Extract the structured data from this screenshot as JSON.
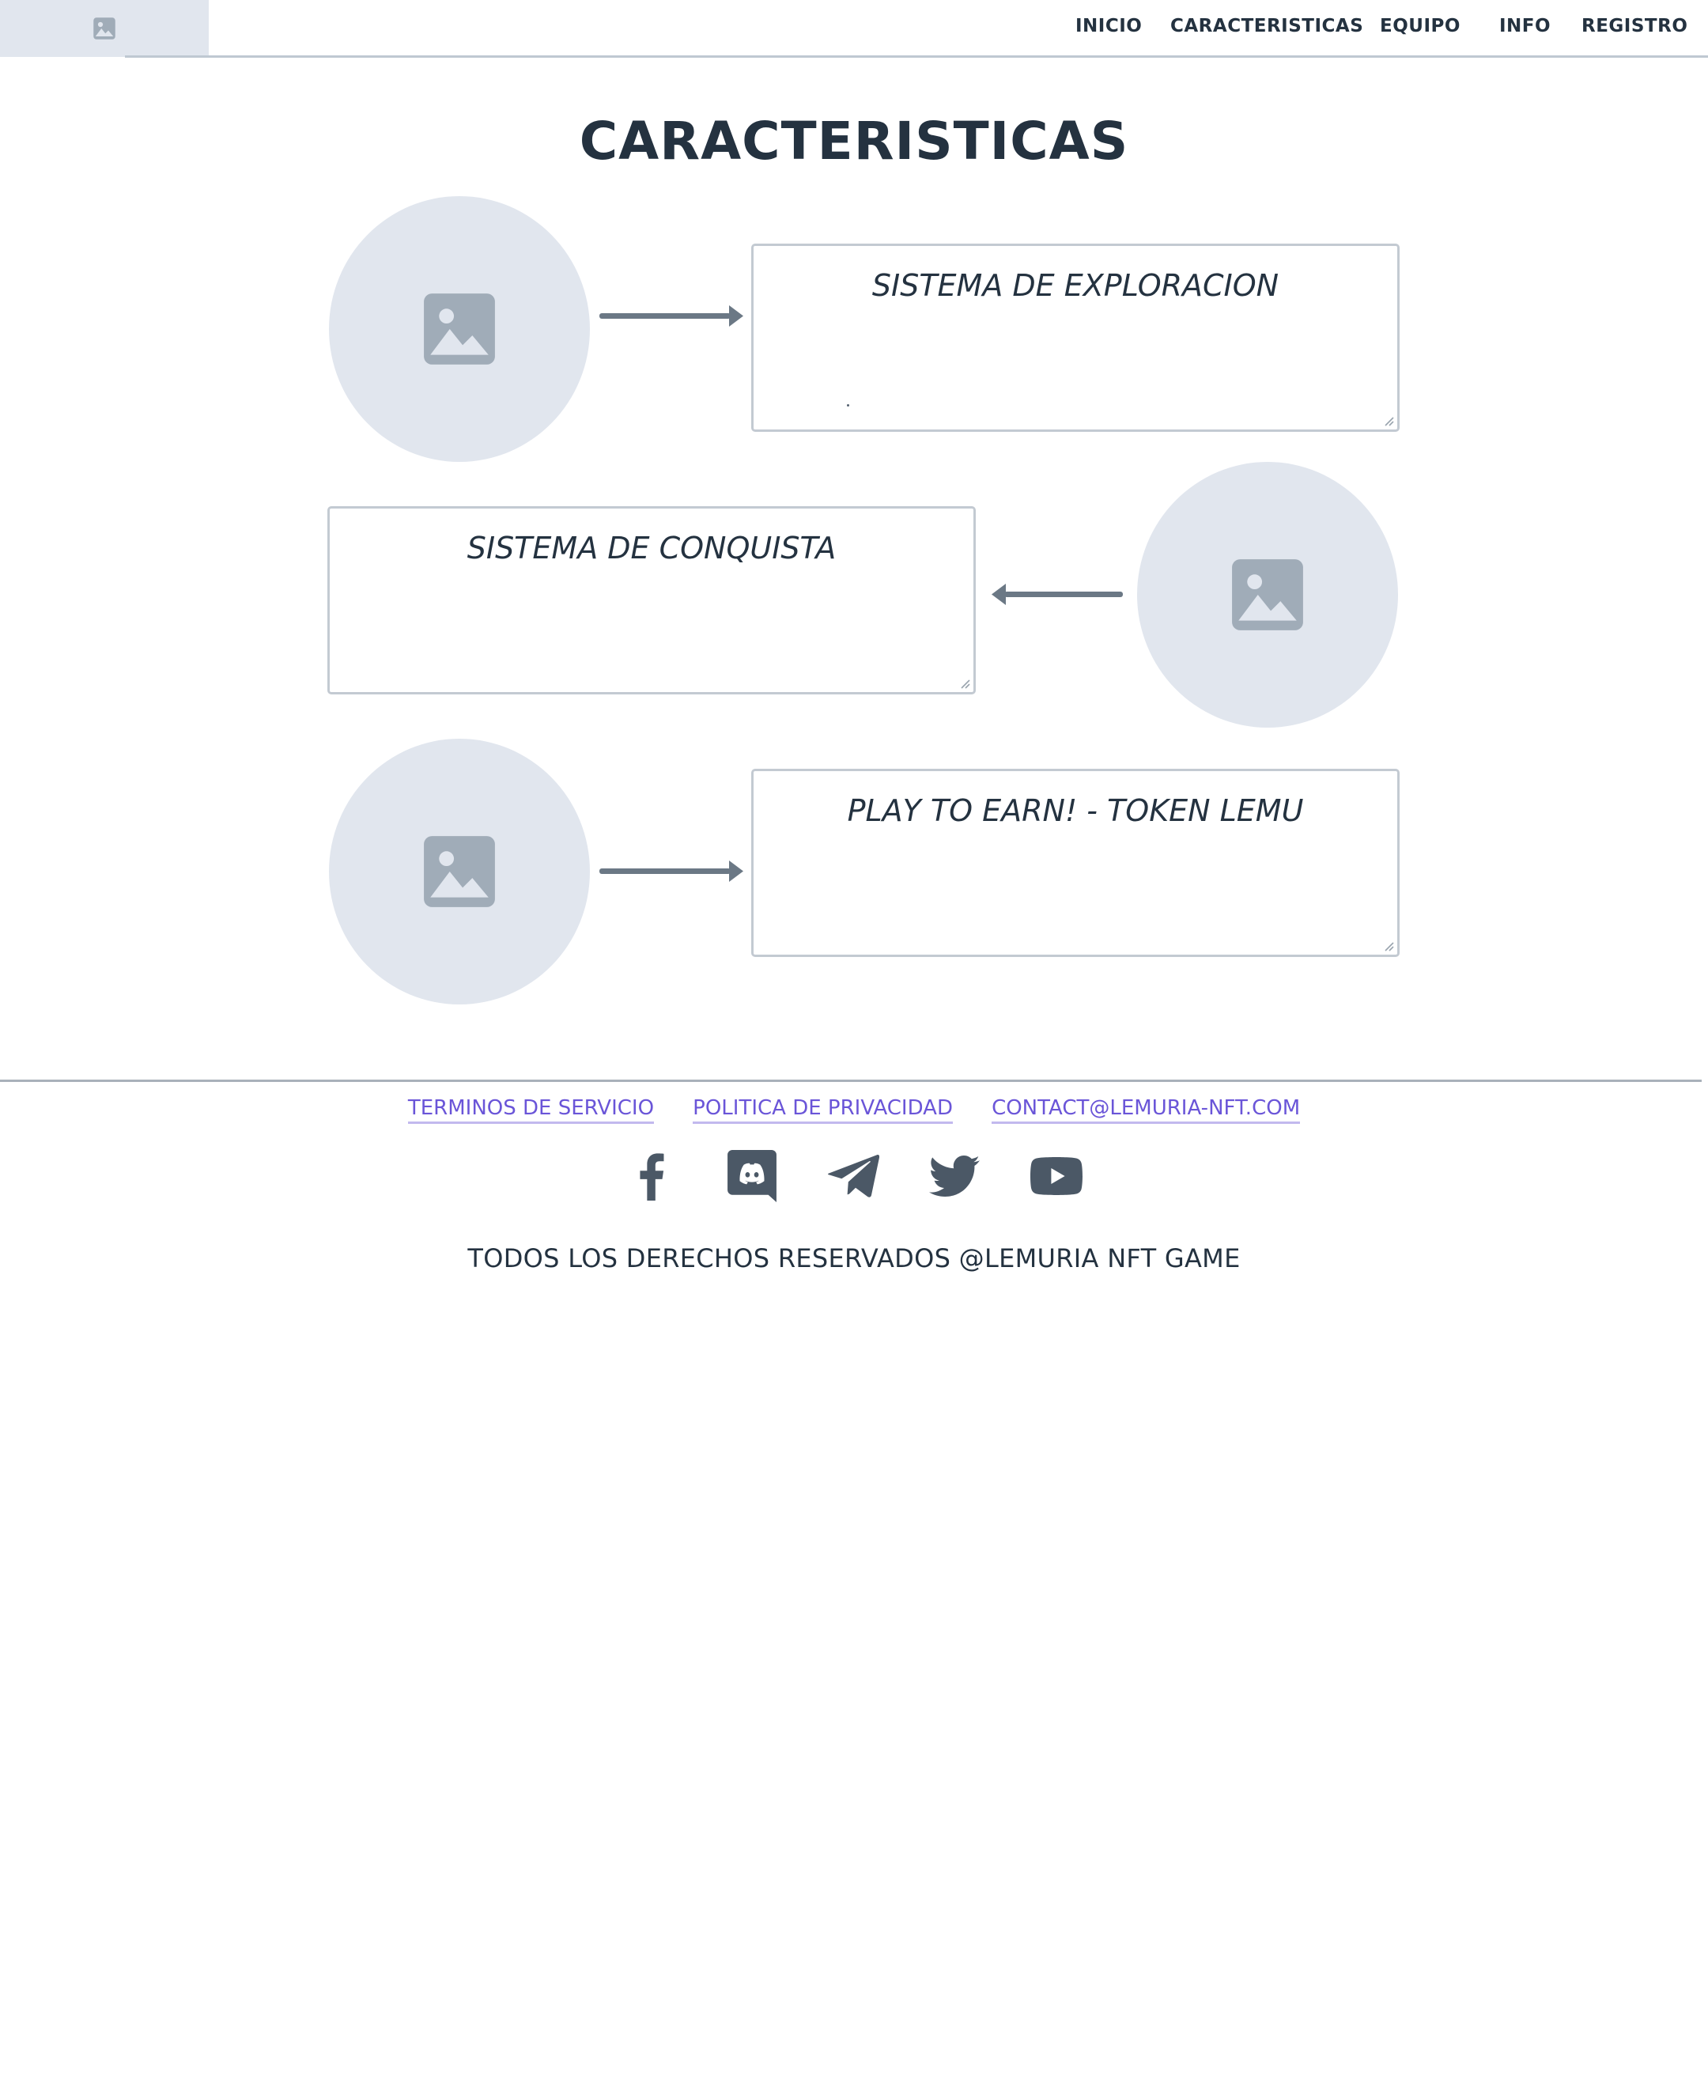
{
  "nav": {
    "logo_icon": "image-placeholder-icon",
    "items": [
      {
        "label": "INICIO"
      },
      {
        "label": "CARACTERISTICAS"
      },
      {
        "label": "EQUIPO"
      },
      {
        "label": "INFO"
      },
      {
        "label": "REGISTRO"
      }
    ]
  },
  "section": {
    "title": "CARACTERISTICAS",
    "features": [
      {
        "title": "SISTEMA DE EXPLORACION",
        "image_icon": "image-placeholder-icon",
        "arrow": "arrow-right-icon"
      },
      {
        "title": "SISTEMA DE CONQUISTA",
        "image_icon": "image-placeholder-icon",
        "arrow": "arrow-left-icon"
      },
      {
        "title": "PLAY TO EARN! - TOKEN LEMU",
        "image_icon": "image-placeholder-icon",
        "arrow": "arrow-right-icon"
      }
    ]
  },
  "footer": {
    "links": [
      {
        "label": "TERMINOS DE SERVICIO"
      },
      {
        "label": "POLITICA DE PRIVACIDAD"
      },
      {
        "label": "CONTACT@LEMURIA-NFT.COM"
      }
    ],
    "social_icons": [
      "facebook-icon",
      "discord-icon",
      "telegram-icon",
      "twitter-icon",
      "youtube-icon"
    ],
    "copyright": "TODOS LOS DERECHOS RESERVADOS @LEMURIA NFT GAME"
  },
  "colors": {
    "text": "#243240",
    "placeholder_bg": "#e1e6ee",
    "placeholder_icon": "#a0acb8",
    "arrow": "#6b7885",
    "link": "#6a55d8",
    "border": "#c3cad2"
  }
}
